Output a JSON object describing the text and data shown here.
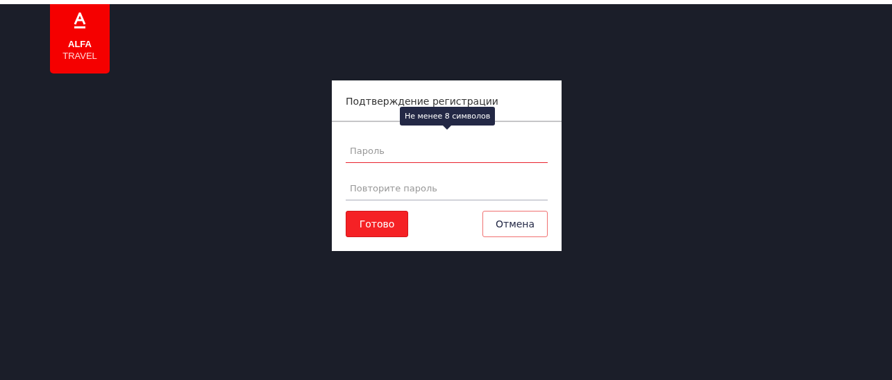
{
  "logo": {
    "brand": "ALFA",
    "subtitle": "TRAVEL"
  },
  "dialog": {
    "title": "Подтверждение регистрации",
    "tooltip": "Не менее 8 символов",
    "fields": [
      {
        "placeholder": "Пароль",
        "focused": true
      },
      {
        "placeholder": "Повторите пароль",
        "focused": false
      }
    ],
    "buttons": [
      {
        "label": "Готово",
        "kind": "primary"
      },
      {
        "label": "Отмена",
        "kind": "secondary"
      }
    ]
  }
}
